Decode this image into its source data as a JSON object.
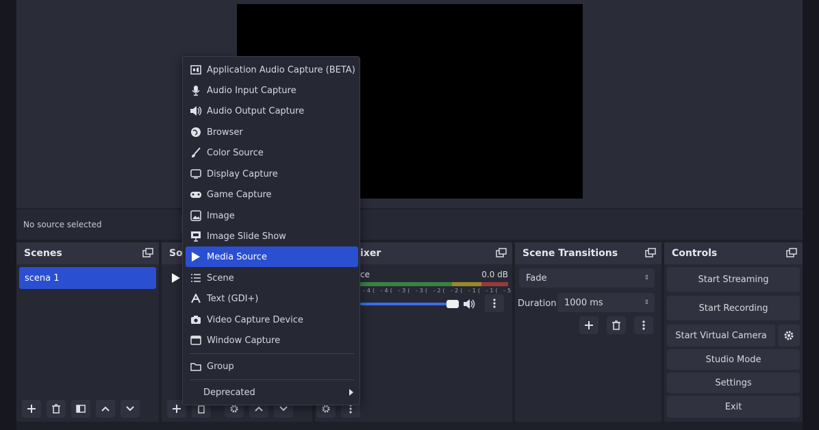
{
  "source_bar": {
    "label": "No source selected"
  },
  "docks": {
    "scenes": {
      "title": "Scenes",
      "items": [
        "scena 1"
      ]
    },
    "sources": {
      "title": "So"
    },
    "mixer": {
      "title": "ixer",
      "channel": "ce",
      "level": "0.0 dB",
      "ticks": "-4( -4( -3( -3( -2( -2( -1( -1( -5  -0"
    },
    "transitions": {
      "title": "Scene Transitions",
      "transition": "Fade",
      "duration_label": "Duration",
      "duration_value": "1000 ms"
    },
    "controls": {
      "title": "Controls",
      "start_streaming": "Start Streaming",
      "start_recording": "Start Recording",
      "start_virtual_camera": "Start Virtual Camera",
      "studio_mode": "Studio Mode",
      "settings": "Settings",
      "exit": "Exit"
    }
  },
  "context_menu": {
    "items": [
      {
        "label": "Application Audio Capture (BETA)",
        "icon": "app-audio-icon"
      },
      {
        "label": "Audio Input Capture",
        "icon": "microphone-icon"
      },
      {
        "label": "Audio Output Capture",
        "icon": "speaker-icon"
      },
      {
        "label": "Browser",
        "icon": "globe-icon"
      },
      {
        "label": "Color Source",
        "icon": "brush-icon"
      },
      {
        "label": "Display Capture",
        "icon": "monitor-icon"
      },
      {
        "label": "Game Capture",
        "icon": "gamepad-icon"
      },
      {
        "label": "Image",
        "icon": "image-icon"
      },
      {
        "label": "Image Slide Show",
        "icon": "slideshow-icon"
      },
      {
        "label": "Media Source",
        "icon": "play-icon"
      },
      {
        "label": "Scene",
        "icon": "list-icon"
      },
      {
        "label": "Text (GDI+)",
        "icon": "text-icon"
      },
      {
        "label": "Video Capture Device",
        "icon": "camera-icon"
      },
      {
        "label": "Window Capture",
        "icon": "window-icon"
      }
    ],
    "group": "Group",
    "deprecated": "Deprecated",
    "selected_index": 9
  },
  "colors": {
    "accent": "#2a4fd0",
    "panel": "#262834",
    "header": "#30323f"
  }
}
